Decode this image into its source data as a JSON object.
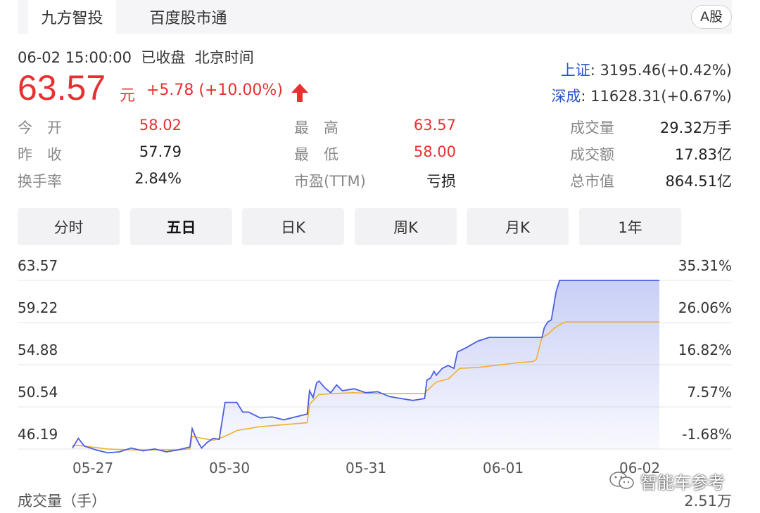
{
  "tabs": [
    {
      "label": "九方智投"
    },
    {
      "label": "百度股市通"
    }
  ],
  "market_badge": "A股",
  "quote": {
    "timestamp": "06-02 15:00:00",
    "status": "已收盘",
    "timezone": "北京时间",
    "price": "63.57",
    "unit": "元",
    "change": "+5.78 (+10.00%)"
  },
  "indices": [
    {
      "name": "上证",
      "value": ": 3195.46(+0.42%)"
    },
    {
      "name": "深成",
      "value": ": 11628.31(+0.67%)"
    }
  ],
  "stats": {
    "open": {
      "label": "今　开",
      "value": "58.02"
    },
    "prev_close": {
      "label": "昨　收",
      "value": "57.79"
    },
    "turnover_rate": {
      "label": "换手率",
      "value": "2.84%"
    },
    "high": {
      "label": "最　高",
      "value": "63.57"
    },
    "low": {
      "label": "最　低",
      "value": "58.00"
    },
    "pe": {
      "label": "市盈(TTM)",
      "value": "亏损"
    },
    "volume": {
      "label": "成交量",
      "value": "29.32万手"
    },
    "amount": {
      "label": "成交额",
      "value": "17.83亿"
    },
    "market_cap": {
      "label": "总市值",
      "value": "864.51亿"
    }
  },
  "periods": [
    {
      "label": "分时"
    },
    {
      "label": "五日"
    },
    {
      "label": "日K"
    },
    {
      "label": "周K"
    },
    {
      "label": "月K"
    },
    {
      "label": "1年"
    }
  ],
  "active_period": "五日",
  "volume_footer": {
    "label": "成交量（手）",
    "value": "2.51万"
  },
  "watermark": "智能车参考",
  "colors": {
    "up": "#e93030",
    "price_line": "#4a5fe0",
    "avg_line": "#f3b02c",
    "index_name": "#2d56cc"
  },
  "chart_data": {
    "type": "line",
    "x": [
      "05-27",
      "05-30",
      "05-31",
      "06-01",
      "06-02"
    ],
    "y_left_ticks": [
      "63.57",
      "59.22",
      "54.88",
      "50.54",
      "46.19"
    ],
    "y_right_ticks": [
      "35.31%",
      "26.06%",
      "16.82%",
      "7.57%",
      "-1.68%"
    ],
    "ylim": [
      46.19,
      63.57
    ],
    "series": [
      {
        "values": [
          [
            0.0,
            46.3
          ],
          [
            0.05,
            47.3
          ],
          [
            0.1,
            46.5
          ],
          [
            0.2,
            46.1
          ],
          [
            0.3,
            45.8
          ],
          [
            0.4,
            45.9
          ],
          [
            0.5,
            46.3
          ],
          [
            0.6,
            46.0
          ],
          [
            0.7,
            46.2
          ],
          [
            0.8,
            45.9
          ],
          [
            0.9,
            46.1
          ],
          [
            1.0,
            46.4
          ],
          [
            1.02,
            48.3
          ],
          [
            1.05,
            47.4
          ],
          [
            1.08,
            46.7
          ],
          [
            1.1,
            46.3
          ],
          [
            1.15,
            46.9
          ],
          [
            1.2,
            47.3
          ],
          [
            1.25,
            47.2
          ],
          [
            1.3,
            51.0
          ],
          [
            1.4,
            51.0
          ],
          [
            1.45,
            50.0
          ],
          [
            1.5,
            50.0
          ],
          [
            1.6,
            49.4
          ],
          [
            1.7,
            49.5
          ],
          [
            1.8,
            49.2
          ],
          [
            1.9,
            49.5
          ],
          [
            2.0,
            49.8
          ],
          [
            2.02,
            52.2
          ],
          [
            2.05,
            51.5
          ],
          [
            2.08,
            53.0
          ],
          [
            2.1,
            53.2
          ],
          [
            2.15,
            52.5
          ],
          [
            2.2,
            52.0
          ],
          [
            2.25,
            52.8
          ],
          [
            2.3,
            52.2
          ],
          [
            2.4,
            52.4
          ],
          [
            2.5,
            52.0
          ],
          [
            2.6,
            52.1
          ],
          [
            2.7,
            51.6
          ],
          [
            2.8,
            51.4
          ],
          [
            2.9,
            51.2
          ],
          [
            3.0,
            51.4
          ],
          [
            3.02,
            53.3
          ],
          [
            3.05,
            53.5
          ],
          [
            3.08,
            54.2
          ],
          [
            3.1,
            53.8
          ],
          [
            3.15,
            54.5
          ],
          [
            3.2,
            54.8
          ],
          [
            3.25,
            54.5
          ],
          [
            3.28,
            56.2
          ],
          [
            3.35,
            56.6
          ],
          [
            3.45,
            57.3
          ],
          [
            3.55,
            57.7
          ],
          [
            3.7,
            57.7
          ],
          [
            3.85,
            57.7
          ],
          [
            4.0,
            57.7
          ],
          [
            4.02,
            58.7
          ],
          [
            4.05,
            59.3
          ],
          [
            4.08,
            59.5
          ],
          [
            4.12,
            62.4
          ],
          [
            4.15,
            63.57
          ],
          [
            4.25,
            63.57
          ],
          [
            4.5,
            63.57
          ],
          [
            4.75,
            63.57
          ],
          [
            5.0,
            63.57
          ]
        ]
      },
      {
        "values": [
          [
            0.0,
            46.6
          ],
          [
            0.1,
            46.5
          ],
          [
            0.3,
            46.2
          ],
          [
            0.5,
            46.1
          ],
          [
            0.7,
            46.1
          ],
          [
            0.9,
            46.1
          ],
          [
            1.0,
            46.2
          ],
          [
            1.02,
            47.5
          ],
          [
            1.1,
            47.3
          ],
          [
            1.2,
            47.1
          ],
          [
            1.3,
            47.5
          ],
          [
            1.4,
            48.1
          ],
          [
            1.6,
            48.5
          ],
          [
            1.8,
            48.7
          ],
          [
            2.0,
            48.9
          ],
          [
            2.02,
            50.8
          ],
          [
            2.1,
            51.8
          ],
          [
            2.2,
            51.9
          ],
          [
            2.4,
            52.0
          ],
          [
            2.6,
            51.9
          ],
          [
            2.8,
            51.9
          ],
          [
            3.0,
            51.9
          ],
          [
            3.02,
            52.2
          ],
          [
            3.1,
            53.1
          ],
          [
            3.2,
            53.4
          ],
          [
            3.3,
            54.5
          ],
          [
            3.45,
            54.6
          ],
          [
            3.6,
            54.8
          ],
          [
            3.8,
            55.1
          ],
          [
            3.92,
            55.2
          ],
          [
            3.95,
            55.4
          ],
          [
            4.0,
            57.7
          ],
          [
            4.05,
            58.0
          ],
          [
            4.1,
            58.6
          ],
          [
            4.15,
            59.0
          ],
          [
            4.2,
            59.3
          ],
          [
            4.4,
            59.3
          ],
          [
            4.7,
            59.3
          ],
          [
            5.0,
            59.3
          ]
        ]
      }
    ]
  }
}
